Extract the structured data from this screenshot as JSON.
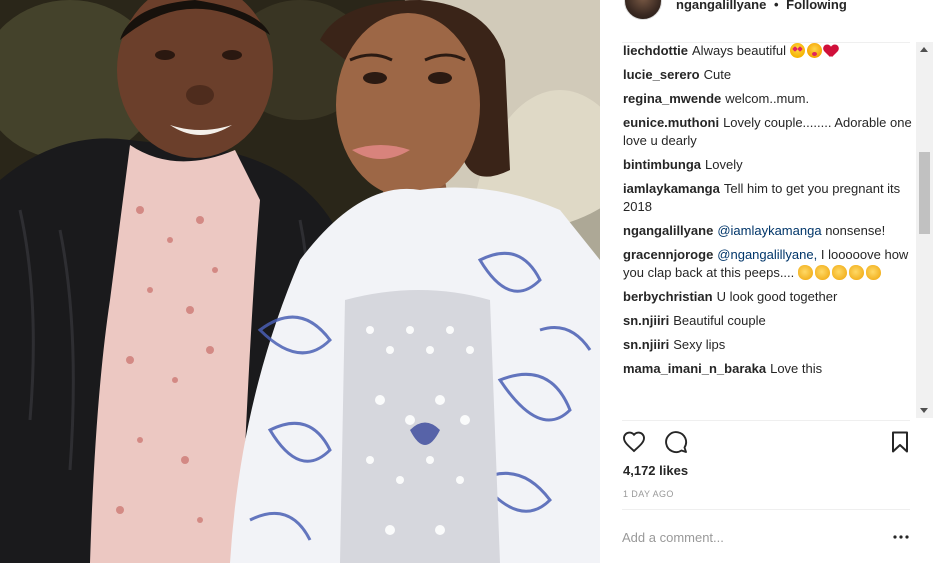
{
  "post": {
    "owner": "ngangalillyane",
    "follow_status": "Following",
    "separator": "•"
  },
  "comments": [
    {
      "user": "liechdottie",
      "text": "Always beautiful",
      "emojis": [
        "heart-eyes",
        "kiss",
        "heart"
      ]
    },
    {
      "user": "lucie_serero",
      "text": "Cute"
    },
    {
      "user": "regina_mwende",
      "text": "welcom..mum."
    },
    {
      "user": "eunice.muthoni",
      "text": "Lovely couple........ Adorable one love u dearly"
    },
    {
      "user": "bintimbunga",
      "text": "Lovely"
    },
    {
      "user": "iamlaykamanga",
      "text": "Tell him to get you pregnant its 2018"
    },
    {
      "user": "ngangalillyane",
      "mention": "@iamlaykamanga",
      "text": "nonsense!"
    },
    {
      "user": "gracennjoroge",
      "mention": "@ngangalillyane,",
      "text": "I looooove how you clap back at this peeps....",
      "emojis": [
        "clap",
        "clap",
        "clap",
        "clap",
        "clap"
      ]
    },
    {
      "user": "berbychristian",
      "text": "U look good together"
    },
    {
      "user": "sn.njiiri",
      "text": "Beautiful couple"
    },
    {
      "user": "sn.njiiri",
      "text": "Sexy lips"
    },
    {
      "user": "mama_imani_n_baraka",
      "text": "Love this"
    }
  ],
  "actions": {
    "like_icon": "heart-outline-icon",
    "comment_icon": "comment-bubble-icon",
    "save_icon": "bookmark-icon"
  },
  "likes": "4,172 likes",
  "timestamp": "1 DAY AGO",
  "add_comment": {
    "placeholder": "Add a comment...",
    "more_icon": "more-options-icon"
  },
  "colors": {
    "text": "#262626",
    "muted": "#999999",
    "mention": "#003569",
    "divider": "#efefef"
  }
}
